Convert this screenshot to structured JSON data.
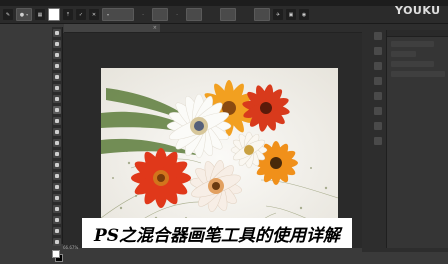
{
  "watermark": "YOUKU",
  "options_bar": {
    "brush_preset_label": "",
    "size_value": "",
    "opacity_label": "",
    "opacity_value": "",
    "flow_label": "",
    "flow_value": ""
  },
  "document_tab": {
    "title": "",
    "close": "×"
  },
  "status": {
    "zoom": "66.67%"
  },
  "caption": "PS之混合器画笔工具的使用详解",
  "colors": {
    "foreground": "#ffffff",
    "background": "#000000",
    "caption_bg": "#ffffff"
  },
  "icons": [
    "move-tool-icon",
    "marquee-tool-icon",
    "lasso-tool-icon",
    "quick-select-icon",
    "crop-tool-icon",
    "eyedropper-icon",
    "healing-brush-icon",
    "brush-tool-icon",
    "clone-stamp-icon",
    "history-brush-icon",
    "eraser-icon",
    "gradient-icon",
    "blur-icon",
    "dodge-icon",
    "pen-icon",
    "type-icon",
    "path-select-icon",
    "shape-icon",
    "hand-icon",
    "zoom-icon"
  ]
}
